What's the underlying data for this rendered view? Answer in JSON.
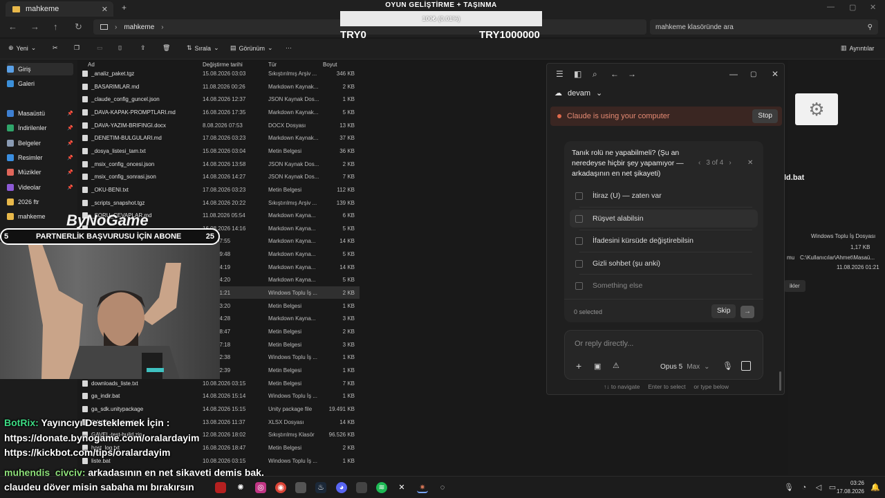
{
  "explorer": {
    "tab_title": "mahkeme",
    "breadcrumb": "mahkeme",
    "search_placeholder": "mahkeme klasöründe ara",
    "toolbar": {
      "new": "Yeni",
      "sort": "Sırala",
      "view": "Görünüm",
      "details": "Ayrıntılar"
    },
    "sidebar": [
      {
        "label": "Giriş"
      },
      {
        "label": "Galeri"
      },
      {
        "label": "Masaüstü"
      },
      {
        "label": "İndirilenler"
      },
      {
        "label": "Belgeler"
      },
      {
        "label": "Resimler"
      },
      {
        "label": "Müzikler"
      },
      {
        "label": "Videolar"
      },
      {
        "label": "2026 ftr"
      },
      {
        "label": "mahkeme"
      }
    ],
    "columns": {
      "name": "Ad",
      "date": "Değiştirme tarihi",
      "type": "Tür",
      "size": "Boyut"
    },
    "files": [
      {
        "name": "_analiz_paket.tgz",
        "date": "15.08.2026 03:03",
        "type": "Sıkıştırılmış Arşiv ...",
        "size": "346 KB"
      },
      {
        "name": "_BASARIMLAR.md",
        "date": "11.08.2026 00:26",
        "type": "Markdown Kaynak...",
        "size": "2 KB"
      },
      {
        "name": "_claude_config_guncel.json",
        "date": "14.08.2026 12:37",
        "type": "JSON Kaynak Dos...",
        "size": "1 KB"
      },
      {
        "name": "_DAVA-KAPAK-PROMPTLARI.md",
        "date": "16.08.2026 17:35",
        "type": "Markdown Kaynak...",
        "size": "5 KB"
      },
      {
        "name": "_DAVA-YAZIM-BRIFINGI.docx",
        "date": "8.08.2026 07:53",
        "type": "DOCX Dosyası",
        "size": "13 KB"
      },
      {
        "name": "_DENETIM-BULGULARI.md",
        "date": "17.08.2026 03:23",
        "type": "Markdown Kaynak...",
        "size": "37 KB"
      },
      {
        "name": "_dosya_listesi_tam.txt",
        "date": "15.08.2026 03:04",
        "type": "Metin Belgesi",
        "size": "36 KB"
      },
      {
        "name": "_msix_config_oncesi.json",
        "date": "14.08.2026 13:58",
        "type": "JSON Kaynak Dos...",
        "size": "2 KB"
      },
      {
        "name": "_msix_config_sonrasi.json",
        "date": "14.08.2026 14:27",
        "type": "JSON Kaynak Dos...",
        "size": "7 KB"
      },
      {
        "name": "_OKU-BENI.txt",
        "date": "17.08.2026 03:23",
        "type": "Metin Belgesi",
        "size": "112 KB"
      },
      {
        "name": "_scripts_snapshot.tgz",
        "date": "14.08.2026 20:22",
        "type": "Sıkıştırılmış Arşiv ...",
        "size": "139 KB"
      },
      {
        "name": "_SORU_CEVAPLAR.md",
        "date": "11.08.2026 05:54",
        "type": "Markdown Kayna...",
        "size": "6 KB"
      },
      {
        "name": "",
        "date": "16.08.2026 14:16",
        "type": "Markdown Kayna...",
        "size": "5 KB"
      },
      {
        "name": "",
        "date": "2026 07:55",
        "type": "Markdown Kayna...",
        "size": "14 KB"
      },
      {
        "name": "",
        "date": "2026 19:48",
        "type": "Markdown Kayna...",
        "size": "5 KB"
      },
      {
        "name": "",
        "date": "2026 14:19",
        "type": "Markdown Kayna...",
        "size": "14 KB"
      },
      {
        "name": "",
        "date": "2026 14:20",
        "type": "Markdown Kayna...",
        "size": "5 KB"
      },
      {
        "name": "",
        "date": "2026 01:21",
        "type": "Windows Toplu İş ...",
        "size": "2 KB"
      },
      {
        "name": "",
        "date": "2026 03:20",
        "type": "Metin Belgesi",
        "size": "1 KB"
      },
      {
        "name": "",
        "date": "2026 04:28",
        "type": "Markdown Kayna...",
        "size": "3 KB"
      },
      {
        "name": "",
        "date": "2026 18:47",
        "type": "Metin Belgesi",
        "size": "2 KB"
      },
      {
        "name": "",
        "date": "2026 17:18",
        "type": "Metin Belgesi",
        "size": "3 KB"
      },
      {
        "name": "",
        "date": "2026 12:38",
        "type": "Windows Toplu İş ...",
        "size": "1 KB"
      },
      {
        "name": "",
        "date": "2026 12:39",
        "type": "Metin Belgesi",
        "size": "1 KB"
      },
      {
        "name": "downloads_liste.txt",
        "date": "10.08.2026 03:15",
        "type": "Metin Belgesi",
        "size": "7 KB"
      },
      {
        "name": "ga_indir.bat",
        "date": "14.08.2026 15:14",
        "type": "Windows Toplu İş ...",
        "size": "1 KB"
      },
      {
        "name": "ga_sdk.unitypackage",
        "date": "14.08.2026 15:15",
        "type": "Unity package file",
        "size": "19.491 KB"
      },
      {
        "name": "GAVEL_Kartlar.xlsx",
        "date": "13.08.2026 11:37",
        "type": "XLSX Dosyası",
        "size": "14 KB"
      },
      {
        "name": "GAVEL-test-build.zip",
        "date": "12.08.2026 18:02",
        "type": "Sıkıştırılmış Klasör",
        "size": "96.526 KB"
      },
      {
        "name": "host_log.txt",
        "date": "16.08.2026 18:47",
        "type": "Metin Belgesi",
        "size": "2 KB"
      },
      {
        "name": "liste.bat",
        "date": "10.08.2026 03:15",
        "type": "Windows Toplu İş ...",
        "size": "1 KB"
      }
    ],
    "rpanel": {
      "filename": "ld.bat",
      "type": "Windows Toplu İş Dosyası",
      "size": "1,17 KB",
      "path_label": "mu",
      "path": "C:\\Kullanıcılar\\Ahmet\\Masaü...",
      "date": "11.08.2026 01:21",
      "btn": "ikler"
    }
  },
  "overlay": {
    "goal_title": "OYUN GELİŞTİRME + TAŞINMA",
    "progress_text": "100₺ (0.01%)",
    "progress_fraction": 0.0001,
    "min_label": "TRY0",
    "max_label": "TRY1000000",
    "brand_a": "By",
    "brand_b": "NoGame",
    "partner_left": "5",
    "partner_text": "PARTNERLİK BAŞVURUSU İÇİN ABONE",
    "partner_right": "25"
  },
  "chat": [
    {
      "user": "BotRix:",
      "text": "Yayıncıyı Desteklemek İçin :"
    },
    {
      "user": "",
      "text": "https://donate.bynogame.com/oralardayim"
    },
    {
      "user": "",
      "text": "https://kickbot.com/tips/oralardayim"
    },
    {
      "user": "muhendis_civciv:",
      "text": "arkadaşının en net şikayeti demiş bak,"
    },
    {
      "user": "",
      "text": "claudeu döver misin sabaha mı bırakırsın"
    }
  ],
  "claude": {
    "folder": "devam",
    "banner": "Claude is using your computer",
    "stop": "Stop",
    "question": "Tanık rolü ne yapabilmeli? (Şu an neredeyse hiçbir şey yapamıyor — arkadaşının en net şikayeti)",
    "pager": "3 of 4",
    "options": [
      "İtiraz (U) — zaten var",
      "Rüşvet alabilsin",
      "İfadesini kürsüde değiştirebilsin",
      "Gizli sohbet (şu anki)",
      "Something else"
    ],
    "selected_count": "0 selected",
    "skip": "Skip",
    "reply_placeholder": "Or reply directly...",
    "model": "Opus 5",
    "effort": "Max",
    "hint_nav": "↑↓ to navigate",
    "hint_select": "Enter to select",
    "hint_type": "or type below"
  },
  "taskbar": {
    "time": "03:26",
    "date": "17.08.2026"
  }
}
